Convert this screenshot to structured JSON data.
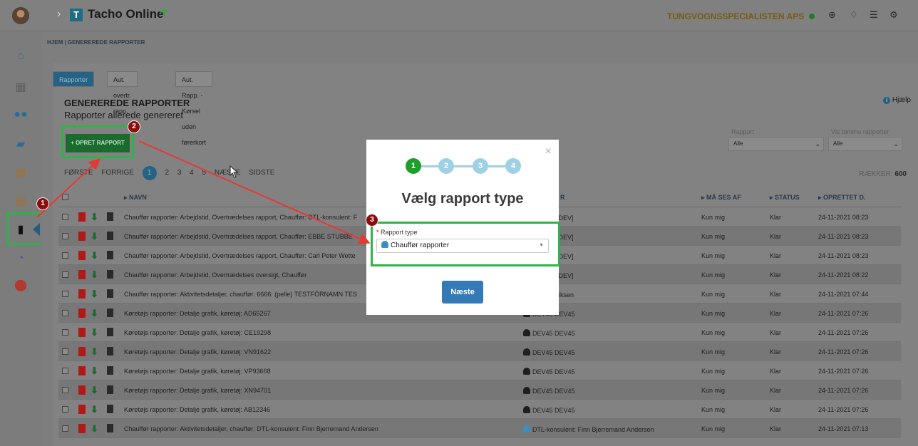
{
  "app": {
    "title": "Tacho Online",
    "plus": "+",
    "chevron": "›"
  },
  "header": {
    "company": "TUNGVOGNSSPECIALISTEN APS"
  },
  "breadcrumb": "HJEM | GENEREREDE RAPPORTER",
  "tabs": [
    "Rapporter",
    "Aut. overtr. rapp.",
    "Aut. Rapp. - Kørsel uden førerkort"
  ],
  "section": {
    "title": "GENEREREDE RAPPORTER",
    "subtitle": "Rapporter allerede genereret",
    "help": "Hjælp"
  },
  "create_button": "+ OPRET RAPPORT",
  "filters": {
    "rapport_label": "Rapport",
    "rapport_value": "Alle",
    "tomme_label": "Vis tomme rapporter",
    "tomme_value": "Alle"
  },
  "pager": {
    "first": "FØRSTE",
    "prev": "FORRIGE",
    "pages": [
      "1",
      "2",
      "3",
      "4",
      "5"
    ],
    "next": "NÆSTE",
    "last": "SIDSTE",
    "rows_label": "RÆKKER:",
    "rows_value": "600"
  },
  "table": {
    "headers": {
      "name": "▸ NAVN",
      "owner": "R",
      "visible": "▸ MÅ SES AF",
      "status": "▸ STATUS",
      "created": "▸ OPRETTET D."
    },
    "rows": [
      {
        "name": "Chauffør rapporter: Arbejdstid, Overtrædelses rapport, Chauffør: DTL-konsulent: F",
        "owner": "umholtz [DEV]",
        "visible": "Kun mig",
        "status": "Klar",
        "created": "24-11-2021 08:23"
      },
      {
        "name": "Chauffør rapporter: Arbejdstid, Overtrædelses rapport, Chauffør: EBBE STUBBE",
        "owner": "umholtz [DEV]",
        "visible": "Kun mig",
        "status": "Klar",
        "created": "24-11-2021 08:23"
      },
      {
        "name": "Chauffør rapporter: Arbejdstid, Overtrædelses rapport, Chauffør: Carl Peter Wette",
        "owner": "umholtz [DEV]",
        "visible": "Kun mig",
        "status": "Klar",
        "created": "24-11-2021 08:23"
      },
      {
        "name": "Chauffør rapporter: Arbejdstid, Overtrædelses oversigt, Chauffør",
        "owner": "umholtz [DEV]",
        "visible": "Kun mig",
        "status": "Klar",
        "created": "24-11-2021 08:22"
      },
      {
        "name": "Chauffør rapporter: Aktivitetsdetaljer, chauffør: 6666: (pelle) TESTFÖRNAMN TES",
        "owner": "er Frederiksen",
        "visible": "Kun mig",
        "status": "Klar",
        "created": "24-11-2021 07:44"
      },
      {
        "name": "Køretøjs rapporter: Detalje grafik, køretøj: AD65267",
        "owner": "DEV45 DEV45",
        "visible": "Kun mig",
        "status": "Klar",
        "created": "24-11-2021 07:26"
      },
      {
        "name": "Køretøjs rapporter: Detalje grafik, køretøj: CE19298",
        "owner": "DEV45 DEV45",
        "visible": "Kun mig",
        "status": "Klar",
        "created": "24-11-2021 07:26"
      },
      {
        "name": "Køretøjs rapporter: Detalje grafik, køretøj: VN91622",
        "owner": "DEV45 DEV45",
        "visible": "Kun mig",
        "status": "Klar",
        "created": "24-11-2021 07:26"
      },
      {
        "name": "Køretøjs rapporter: Detalje grafik, køretøj: VP93668",
        "owner": "DEV45 DEV45",
        "visible": "Kun mig",
        "status": "Klar",
        "created": "24-11-2021 07:26"
      },
      {
        "name": "Køretøjs rapporter: Detalje grafik, køretøj: XN94701",
        "owner": "DEV45 DEV45",
        "visible": "Kun mig",
        "status": "Klar",
        "created": "24-11-2021 07:26"
      },
      {
        "name": "Køretøjs rapporter: Detalje grafik, køretøj: AB12346",
        "owner": "DEV45 DEV45",
        "visible": "Kun mig",
        "status": "Klar",
        "created": "24-11-2021 07:26"
      },
      {
        "name": "Chauffør rapporter: Aktivitetsdetaljer, chauffør: DTL-konsulent: Finn Bjerremand Andersen",
        "owner": "DTL-konsulent: Finn Bjerremand Andersen",
        "visible": "Kun mig",
        "status": "Klar",
        "created": "24-11-2021 07:13"
      }
    ]
  },
  "modal": {
    "steps": [
      "1",
      "2",
      "3",
      "4"
    ],
    "close": "×",
    "title": "Vælg rapport type",
    "field_required": "*",
    "field_label": "Rapport type",
    "field_value": "Chauffør rapporter",
    "next_button": "Næste"
  },
  "badges": [
    "1",
    "2",
    "3"
  ],
  "colors": {
    "highlight": "#2db34a",
    "arrow": "#e53935",
    "badge": "#8b0d0d",
    "primary": "#337ab7"
  }
}
